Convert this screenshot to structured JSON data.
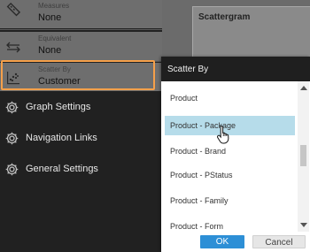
{
  "sidebar": {
    "properties": [
      {
        "label": "Measures",
        "value": "None",
        "icon": "ruler-icon"
      },
      {
        "label": "Equivalent",
        "value": "None",
        "icon": "equivalent-arrows-icon"
      },
      {
        "label": "Scatter By",
        "value": "Customer",
        "icon": "scatter-icon"
      }
    ],
    "nav": [
      {
        "label": "Graph Settings",
        "icon": "gear-icon"
      },
      {
        "label": "Navigation Links",
        "icon": "gear-icon"
      },
      {
        "label": "General Settings",
        "icon": "gear-icon"
      }
    ]
  },
  "canvas": {
    "graph_title": "Scattergram"
  },
  "dialog": {
    "title": "Scatter By",
    "options": [
      {
        "label": "Product",
        "selected": false
      },
      {
        "label": "Product - Package",
        "selected": true
      },
      {
        "label": "Product - Brand",
        "selected": false
      },
      {
        "label": "Product - PStatus",
        "selected": false
      },
      {
        "label": "Product - Family",
        "selected": false
      },
      {
        "label": "Product - Form",
        "selected": false
      }
    ],
    "ok_label": "OK",
    "cancel_label": "Cancel"
  },
  "colors": {
    "highlight": "#f5a04a",
    "selected_row": "#b6dcea",
    "ok_button": "#2d8fd6"
  }
}
